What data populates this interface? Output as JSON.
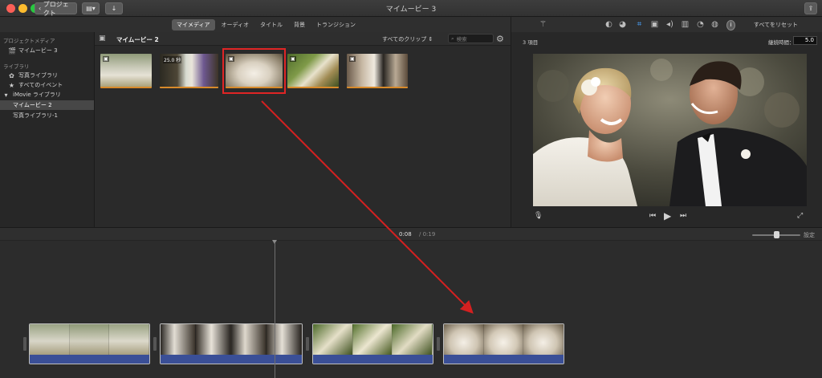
{
  "window": {
    "title": "マイムービー 3",
    "projects_label": "プロジェクト"
  },
  "tabs": [
    {
      "label": "マイメディア",
      "active": true
    },
    {
      "label": "オーディオ",
      "active": false
    },
    {
      "label": "タイトル",
      "active": false
    },
    {
      "label": "背景",
      "active": false
    },
    {
      "label": "トランジション",
      "active": false
    }
  ],
  "viewer_toolbar": {
    "reset_all": "すべてをリセット"
  },
  "sidebar": {
    "project_media_header": "プロジェクトメディア",
    "project_item": "マイムービー 3",
    "library_header": "ライブラリ",
    "photos_library": "写真ライブラリ",
    "all_events": "すべてのイベント",
    "imovie_library": "iMovie ライブラリ",
    "selected_event": "マイムービー 2",
    "photo_library_1": "写真ライブラリ-1"
  },
  "browser": {
    "title": "マイムービー 2",
    "filter": "すべてのクリップ",
    "search_placeholder": "検索",
    "thumb_date": "25.0 秒"
  },
  "viewer": {
    "clip_count": "3 項目",
    "duration_label": "継続時間：",
    "duration_value": "5.0"
  },
  "timeline": {
    "current_time": "0:08",
    "separator": "/",
    "total_time": "0:19",
    "settings_label": "設定"
  },
  "colors": {
    "highlight": "#e02525",
    "arrow": "#d42020",
    "audio_track": "#3a4f97",
    "clip_underline": "#d88a2a"
  }
}
